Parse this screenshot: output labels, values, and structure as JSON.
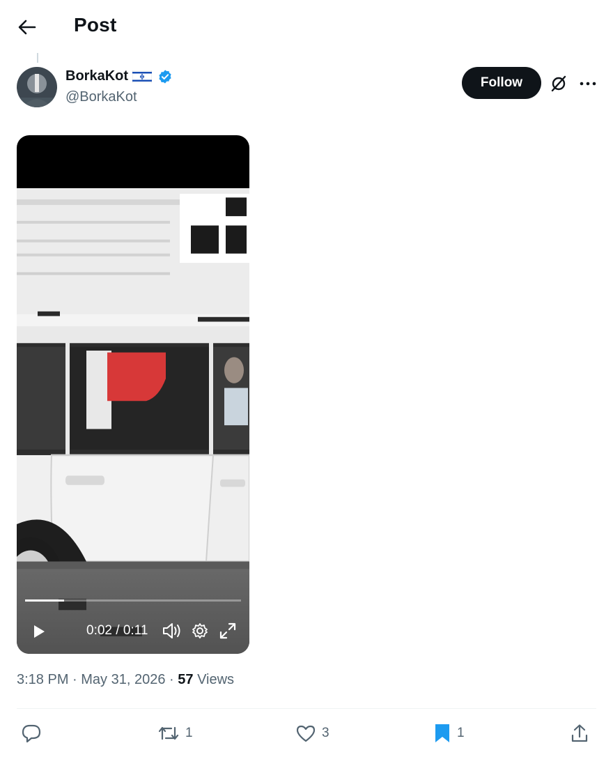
{
  "header": {
    "title": "Post",
    "back_icon": "arrow-left-icon"
  },
  "author": {
    "display_name": "BorkaKot",
    "flag_icon": "israel-flag-icon",
    "verified_icon": "verified-badge-icon",
    "handle": "@BorkaKot",
    "follow_label": "Follow"
  },
  "video": {
    "current_time": "0:02",
    "duration": "0:11",
    "time_display": "0:02 / 0:11",
    "progress_fraction": 0.18
  },
  "meta": {
    "time": "3:18 PM",
    "date": "May 31, 2026",
    "views_count": "57",
    "views_label": "Views"
  },
  "actions": {
    "replies": "",
    "reposts": "1",
    "likes": "3",
    "bookmarks": "1"
  },
  "colors": {
    "accent": "#1d9bf0",
    "text": "#0f1419",
    "muted": "#536471",
    "follow_bg": "#0f1419"
  }
}
